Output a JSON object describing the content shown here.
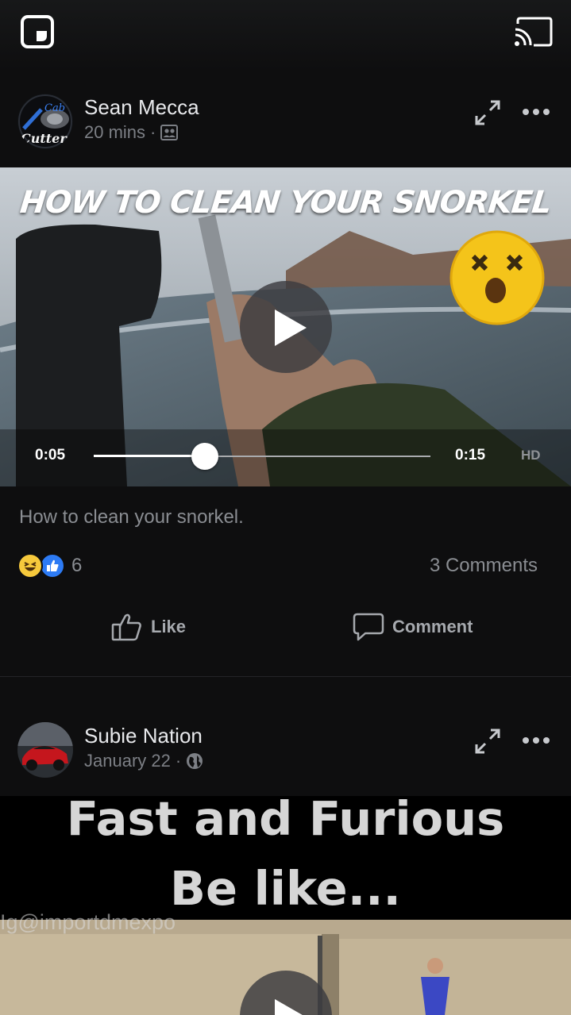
{
  "top_bar": {
    "pip_icon": "picture-in-picture-icon",
    "cast_icon": "cast-icon"
  },
  "posts": [
    {
      "author": "Sean Mecca",
      "time": "20 mins",
      "privacy_icon": "friends-icon",
      "video": {
        "overlay_title": "HOW TO CLEAN YOUR SNORKEL",
        "current_time": "0:05",
        "duration": "0:15",
        "quality_label": "HD",
        "progress_fraction": 0.33
      },
      "caption": "How to clean your snorkel.",
      "reaction_icons": [
        "haha-icon",
        "like-icon"
      ],
      "reaction_count": "6",
      "comments": "3 Comments",
      "actions": {
        "like": "Like",
        "comment": "Comment"
      }
    },
    {
      "author": "Subie Nation",
      "time": "January 22",
      "privacy_icon": "globe-icon",
      "video": {
        "overlay_line1": "Fast and Furious",
        "overlay_line2": "Be like...",
        "watermark": "Ig@importdmexpo"
      }
    }
  ]
}
